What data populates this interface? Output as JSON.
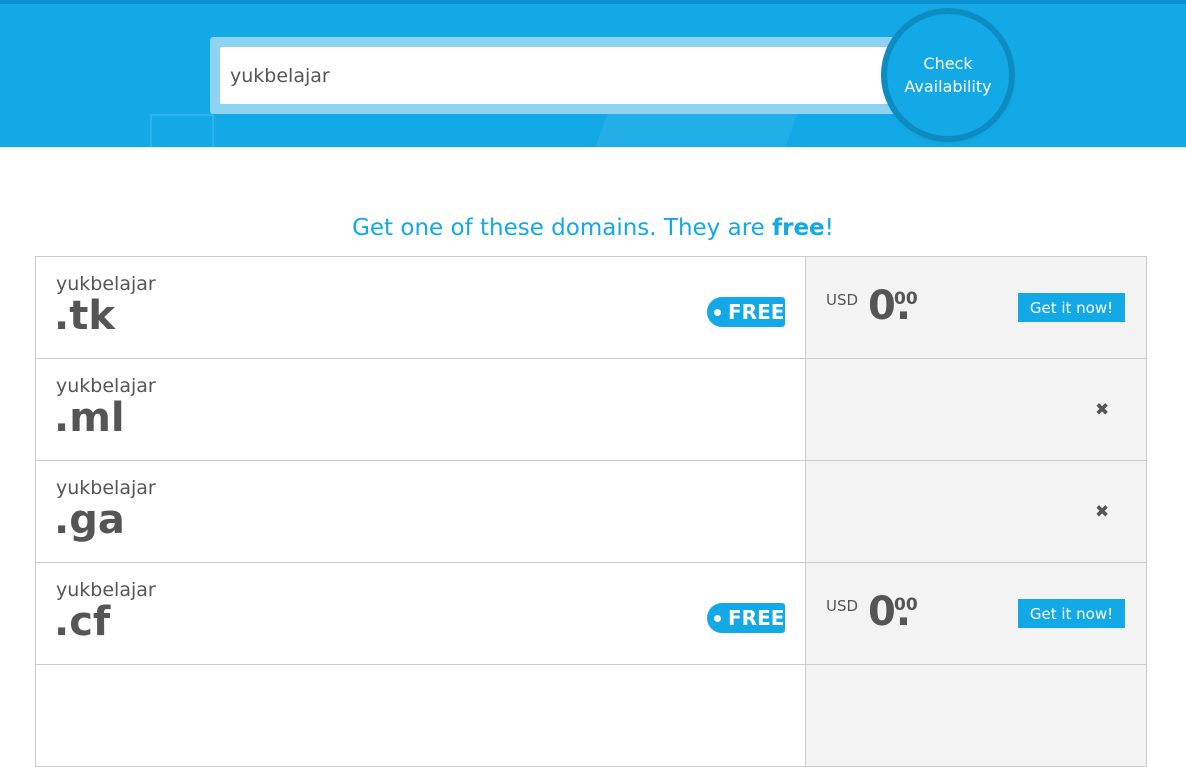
{
  "search": {
    "value": "yukbelajar",
    "button_line1": "Check",
    "button_line2": "Availability"
  },
  "heading": {
    "text": "Get one of these domains. They are ",
    "emphasis": "free",
    "end": "!"
  },
  "rows": [
    {
      "name": "yukbelajar",
      "tld": ".tk",
      "badge": "FREE",
      "currency": "USD",
      "price_int": "0.",
      "price_cents": "00",
      "action": "Get it now!"
    },
    {
      "name": "yukbelajar",
      "tld": ".ml",
      "status_icon": "close-icon",
      "status": "✖"
    },
    {
      "name": "yukbelajar",
      "tld": ".ga",
      "status_icon": "close-icon",
      "status": "✖"
    },
    {
      "name": "yukbelajar",
      "tld": ".cf",
      "badge": "FREE",
      "currency": "USD",
      "price_int": "0.",
      "price_cents": "00",
      "action": "Get it now!"
    }
  ],
  "colors": {
    "accent": "#12a9e6",
    "row_bg": "#f3f3f3"
  }
}
